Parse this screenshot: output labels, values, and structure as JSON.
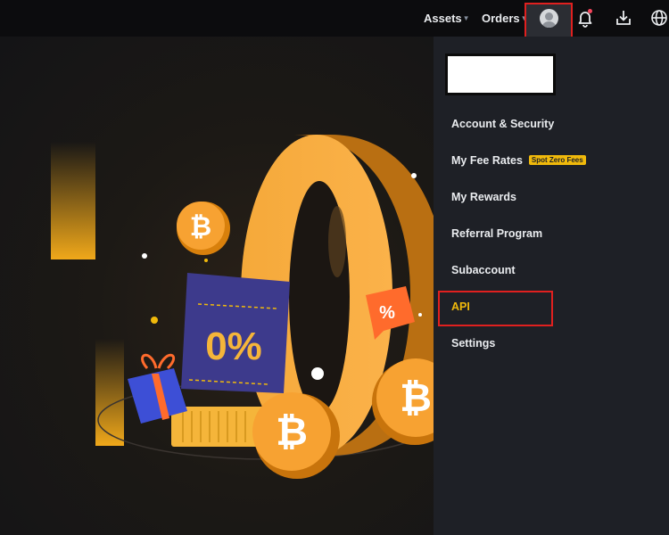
{
  "topbar": {
    "nav": [
      {
        "label": "Assets"
      },
      {
        "label": "Orders"
      }
    ],
    "icons": [
      "user-icon",
      "bell-icon",
      "download-icon",
      "globe-icon"
    ],
    "notification_dot": true
  },
  "banner": {
    "promo_text": "0%",
    "big_digit": "0",
    "percent_tag": "%"
  },
  "dropdown": {
    "menu": [
      {
        "label": "Account & Security"
      },
      {
        "label": "My Fee Rates",
        "badge": "Spot Zero Fees"
      },
      {
        "label": "My Rewards"
      },
      {
        "label": "Referral Program"
      },
      {
        "label": "Subaccount"
      },
      {
        "label": "API",
        "active": true
      },
      {
        "label": "Settings"
      }
    ]
  },
  "colors": {
    "accent": "#f0b90b",
    "highlight_border": "#e0201f",
    "menu_background": "#1e2026",
    "topbar_background": "#0c0c0e"
  }
}
